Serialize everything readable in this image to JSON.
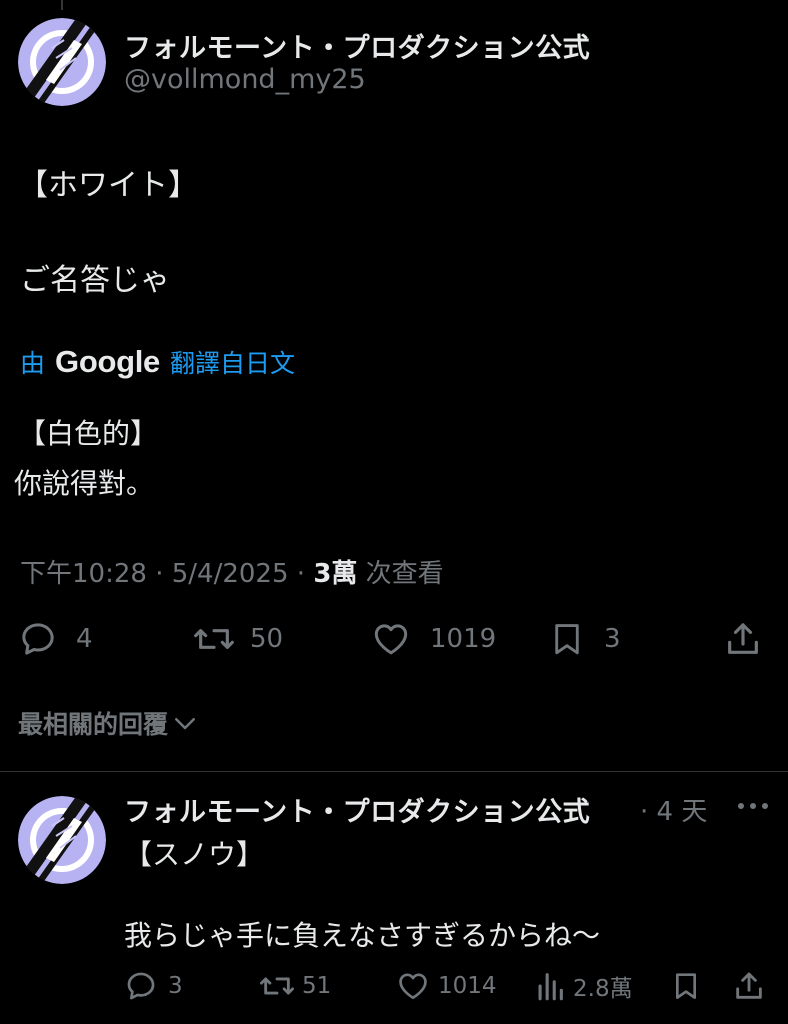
{
  "main_post": {
    "author_name": "フォルモーント・プロダクション公式",
    "handle": "@vollmond_my25",
    "lines": [
      "【ホワイト】",
      "ご名答じゃ"
    ],
    "translation": {
      "prefix": "由",
      "brand": "Google",
      "suffix": "翻譯自日文",
      "lines": [
        "【白色的】",
        "你說得對。"
      ]
    },
    "meta": {
      "time": "下午10:28",
      "sep": "·",
      "date": "5/4/2025",
      "views_count": "3萬",
      "views_label": "次查看"
    },
    "actions": {
      "replies": "4",
      "reposts": "50",
      "likes": "1019",
      "bookmarks": "3"
    }
  },
  "sort_label": "最相關的回覆",
  "reply": {
    "author_name": "フォルモーント・プロダクション公式",
    "time": "· 4 天",
    "lines": [
      "【スノウ】",
      "我らじゃ手に負えなさすぎるからね～"
    ],
    "actions": {
      "replies": "3",
      "reposts": "51",
      "likes": "1014",
      "views": "2.8萬"
    }
  },
  "colors": {
    "background": "#000000",
    "text": "#e7e9ea",
    "muted": "#71767b",
    "link": "#1d9bf0",
    "divider": "#2f3336",
    "avatar_bg": "#b7b3f2"
  }
}
